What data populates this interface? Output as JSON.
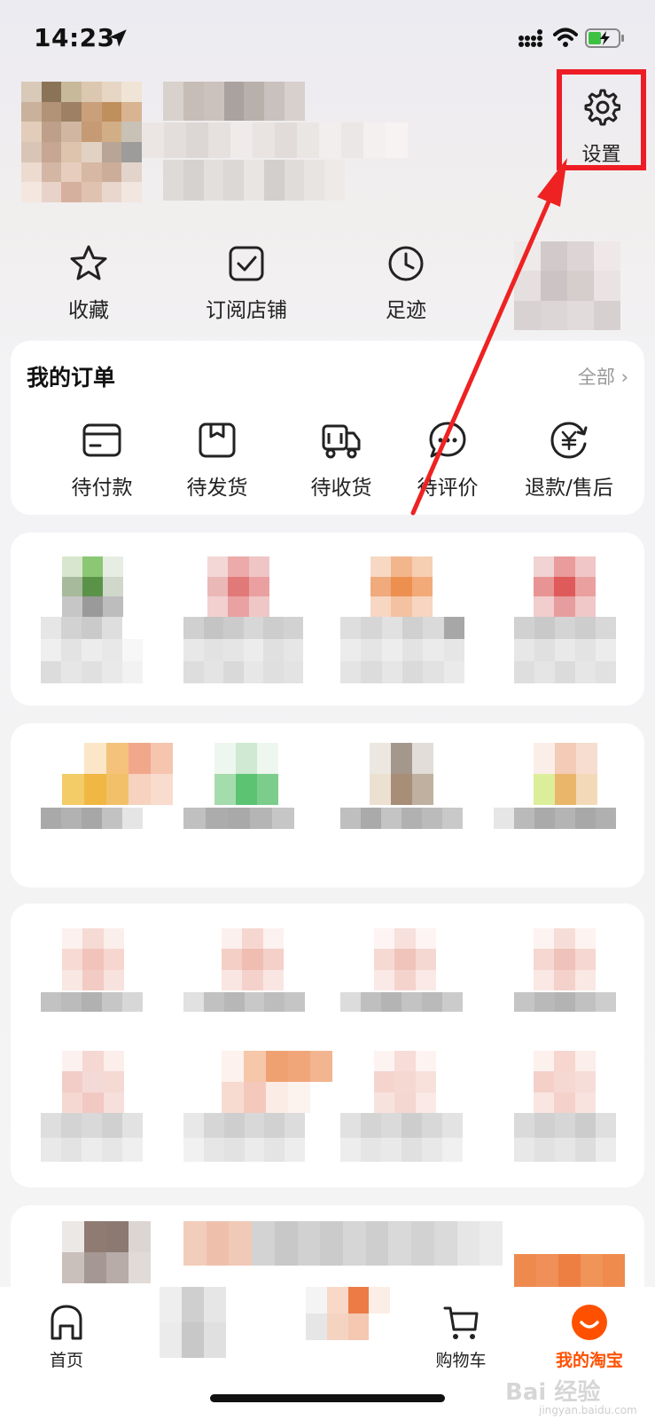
{
  "status_bar": {
    "time": "14:23"
  },
  "header": {
    "settings_label": "设置"
  },
  "quick_links": [
    {
      "label": "收藏",
      "icon": "star-icon"
    },
    {
      "label": "订阅店铺",
      "icon": "checkbox-icon"
    },
    {
      "label": "足迹",
      "icon": "clock-icon"
    }
  ],
  "orders": {
    "title": "我的订单",
    "all_label": "全部 ›",
    "items": [
      {
        "label": "待付款",
        "icon": "card-icon"
      },
      {
        "label": "待发货",
        "icon": "package-icon"
      },
      {
        "label": "待收货",
        "icon": "truck-icon"
      },
      {
        "label": "待评价",
        "icon": "chat-icon"
      },
      {
        "label": "退款/售后",
        "icon": "yuan-refund-icon"
      }
    ]
  },
  "tab_bar": {
    "items": [
      {
        "label": "首页",
        "icon": "home-icon"
      },
      {
        "label": "购物车",
        "icon": "cart-icon"
      },
      {
        "label": "我的淘宝",
        "icon": "my-taobao-icon",
        "active": true
      }
    ]
  },
  "watermark": {
    "text": "Bai 经验",
    "sub": "jingyan.baidu.com"
  },
  "colors": {
    "accent": "#ff5000",
    "highlight_box": "#ee1c25"
  }
}
